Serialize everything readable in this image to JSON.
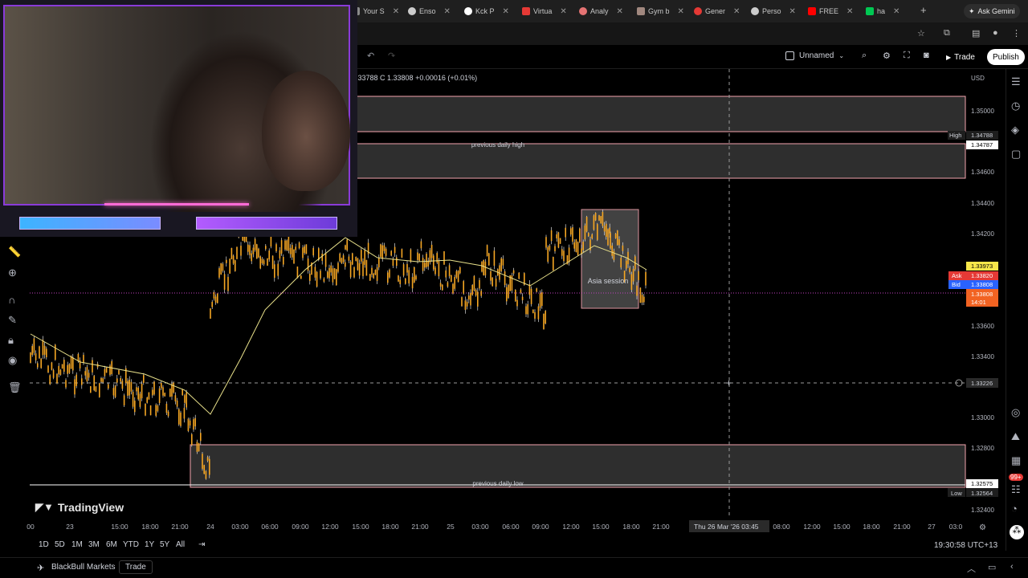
{
  "browser": {
    "tabs": [
      {
        "label": "Your S",
        "color": "#8a8a8a"
      },
      {
        "label": "Enso",
        "color": "#cccccc"
      },
      {
        "label": "Kck P",
        "color": "#ffffff"
      },
      {
        "label": "Virtua",
        "color": "#e53935"
      },
      {
        "label": "Analy",
        "color": "#e57373"
      },
      {
        "label": "Gym b",
        "color": "#a1887f"
      },
      {
        "label": "Gener",
        "color": "#e53935"
      },
      {
        "label": "Perso",
        "color": "#cccccc"
      },
      {
        "label": "FREE",
        "color": "#ff0000"
      },
      {
        "label": "ha",
        "color": "#00c853"
      }
    ],
    "new_tab": "+",
    "ask_gemini": "Ask Gemini"
  },
  "toolbar": {
    "layout_name": "Unnamed",
    "trade_label": "Trade",
    "publish_label": "Publish"
  },
  "chart": {
    "ohlc_text": "1.33788  C 1.33808  +0.00016 (+0.01%)",
    "currency": "USD",
    "price_labels": [
      "1.35000",
      "1.34600",
      "1.34400",
      "1.34200",
      "1.33600",
      "1.33400",
      "1.33000",
      "1.32800",
      "1.32400"
    ],
    "high_label": "High",
    "high_price": "1.34788",
    "high_marker": "1.34787",
    "yellow_price": "1.33973",
    "ask_label": "Ask",
    "ask_price": "1.33820",
    "bid_label": "Bid",
    "bid_price": "1.33808",
    "last_price": "1.33808",
    "countdown": "14:01",
    "crosshair_price": "1.33226",
    "low_marker": "1.32575",
    "low_label": "Low",
    "low_price": "1.32564",
    "prev_high_text": "previous daily high",
    "prev_low_text": "previous daily low",
    "asia_text": "Asia session",
    "time_labels": [
      "00",
      "23",
      "15:00",
      "18:00",
      "21:00",
      "24",
      "03:00",
      "06:00",
      "09:00",
      "12:00",
      "15:00",
      "18:00",
      "21:00",
      "25",
      "03:00",
      "06:00",
      "09:00",
      "12:00",
      "15:00",
      "18:00",
      "21:00",
      "08:00",
      "12:00",
      "15:00",
      "18:00",
      "21:00",
      "27",
      "03:0"
    ],
    "crosshair_time": "Thu 26 Mar '26   03:45",
    "colors": {
      "zone_border": "#f4a4ae",
      "zone_fill": "#2e2e2e",
      "candle": "#f5a623",
      "wick": "#ffffff",
      "ma": "#e8e08a",
      "asia_fill": "#4a4a4a"
    }
  },
  "logo": {
    "text": "TradingView"
  },
  "ranges": [
    "1D",
    "5D",
    "1M",
    "3M",
    "6M",
    "YTD",
    "1Y",
    "5Y",
    "All"
  ],
  "clock": "19:30:58 UTC+13",
  "broker": {
    "name": "BlackBull Markets",
    "trade": "Trade"
  },
  "badge": "99+"
}
